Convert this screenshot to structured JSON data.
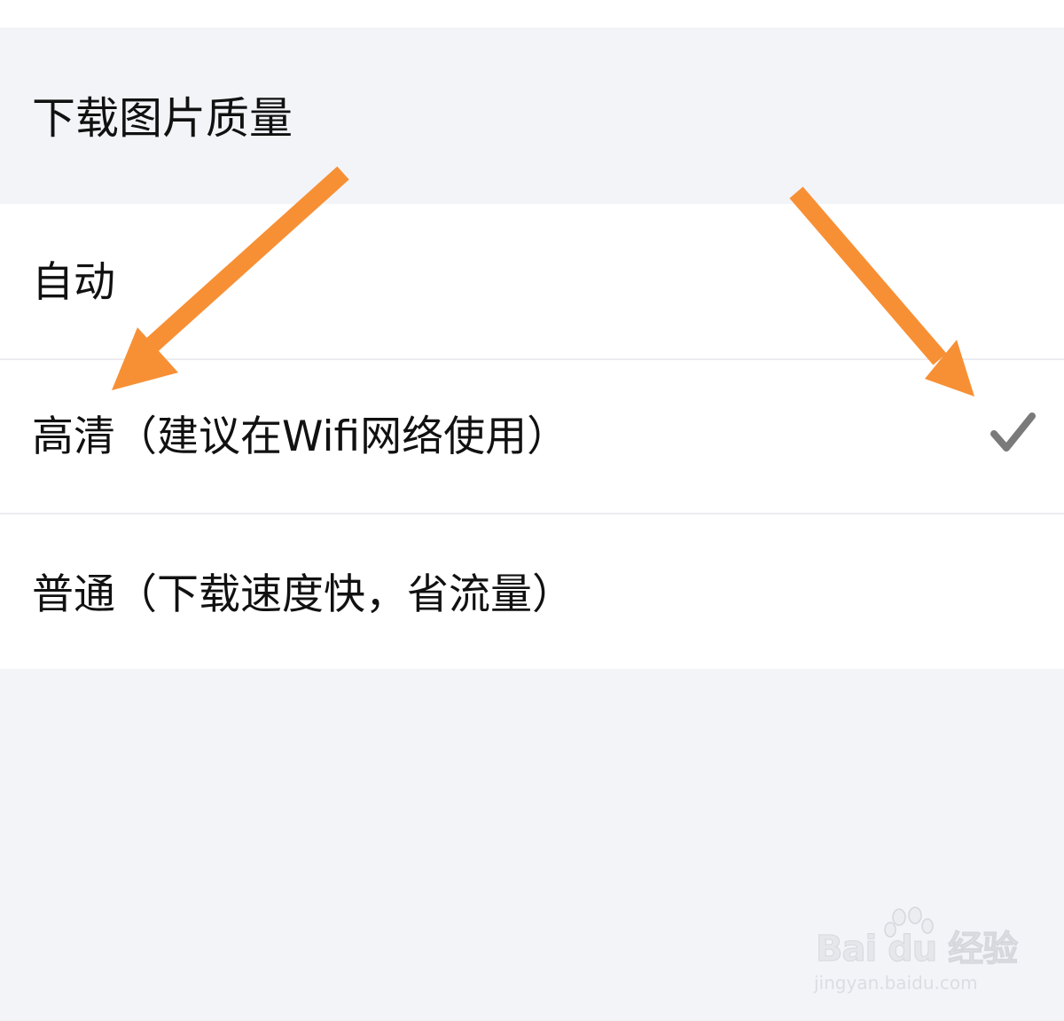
{
  "settings": {
    "section_title": "下载图片质量",
    "options": [
      {
        "label": "自动",
        "selected": false
      },
      {
        "label": "高清（建议在Wifi网络使用）",
        "selected": true
      },
      {
        "label": "普通（下载速度快，省流量）",
        "selected": false
      }
    ],
    "selected_icon": "checkmark-icon"
  },
  "annotations": {
    "arrow_color": "#f79035",
    "arrows": [
      "arrow-down-left-icon",
      "arrow-down-right-icon"
    ]
  },
  "watermark": {
    "logo_text": "Bai du 经验",
    "url": "jingyan.baidu.com"
  },
  "colors": {
    "page_background": "#f3f4f8",
    "row_background": "#ffffff",
    "text": "#111111",
    "checkmark": "#7a7a7a",
    "divider": "#ececf0"
  }
}
